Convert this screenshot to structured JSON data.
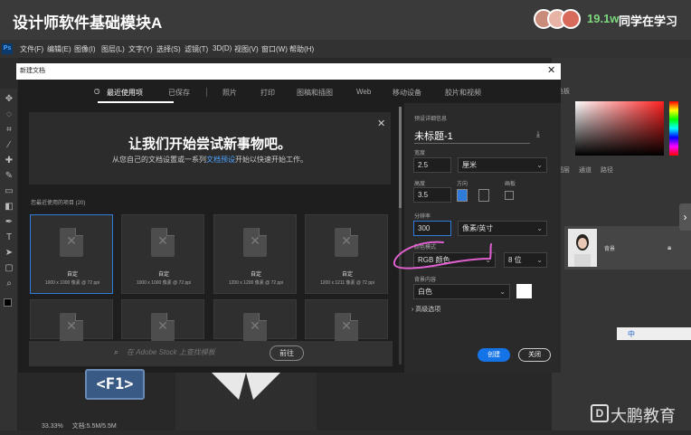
{
  "course": {
    "title": "设计师软件基础模块A",
    "learner_count": "19.1w",
    "learner_text": "同学在学习"
  },
  "menubar": {
    "items": [
      "文件(F)",
      "编辑(E)",
      "图像(I)",
      "图层(L)",
      "文字(Y)",
      "选择(S)",
      "滤镜(T)",
      "3D(D)",
      "视图(V)",
      "窗口(W)",
      "帮助(H)"
    ]
  },
  "dialog": {
    "title": "新建文档",
    "tabs": [
      "最近使用项",
      "已保存",
      "照片",
      "打印",
      "图稿和插图",
      "Web",
      "移动设备",
      "胶片和视频"
    ],
    "banner": {
      "title": "让我们开始尝试新事物吧。",
      "sub_before": "从您自己的文档设置或一系列",
      "sub_link": "文档预设",
      "sub_after": "开始以快速开始工作。"
    },
    "recent_label": "您最近使用的项目 (20)",
    "presets": [
      {
        "name": "自定",
        "spec": "1000 x 1000 像素 @ 72 ppi"
      },
      {
        "name": "自定",
        "spec": "1000 x 1000 像素 @ 72 ppi"
      },
      {
        "name": "自定",
        "spec": "1200 x 1200 像素 @ 72 ppi"
      },
      {
        "name": "自定",
        "spec": "1200 x 1211 像素 @ 72 ppi"
      }
    ],
    "stock": {
      "placeholder": "在 Adobe Stock 上查找模板",
      "go_label": "前往"
    },
    "details": {
      "section_label": "预设详细信息",
      "doc_name": "未标题-1",
      "width_label": "宽度",
      "width_value": "2.5",
      "width_unit": "厘米",
      "height_label": "高度",
      "height_value": "3.5",
      "orientation_label": "方向",
      "artboard_label": "画板",
      "resolution_label": "分辨率",
      "resolution_value": "300",
      "resolution_unit": "像素/英寸",
      "color_mode_label": "颜色模式",
      "color_mode_value": "RGB 颜色",
      "bit_depth": "8 位",
      "bg_label": "背景内容",
      "bg_value": "白色",
      "bg_color": "#ffffff",
      "advanced_label": "高级选项"
    },
    "buttons": {
      "create": "创建",
      "close": "关闭"
    }
  },
  "overlay": {
    "key_label": "<F1>"
  },
  "status": {
    "zoom": "33.33%",
    "doc_info": "文档:5.5M/5.5M"
  },
  "right_panel": {
    "tabs_top": [
      "色板"
    ],
    "tabs_layers": [
      "图层",
      "通道",
      "路径"
    ],
    "layer_name": "背景",
    "ime_text": "中"
  },
  "watermark": {
    "logo": "D",
    "text": "大鹏教育"
  },
  "colors": {
    "accent": "#1473e6",
    "annotation": "#e060d0",
    "key_bg": "#3a5a86"
  }
}
